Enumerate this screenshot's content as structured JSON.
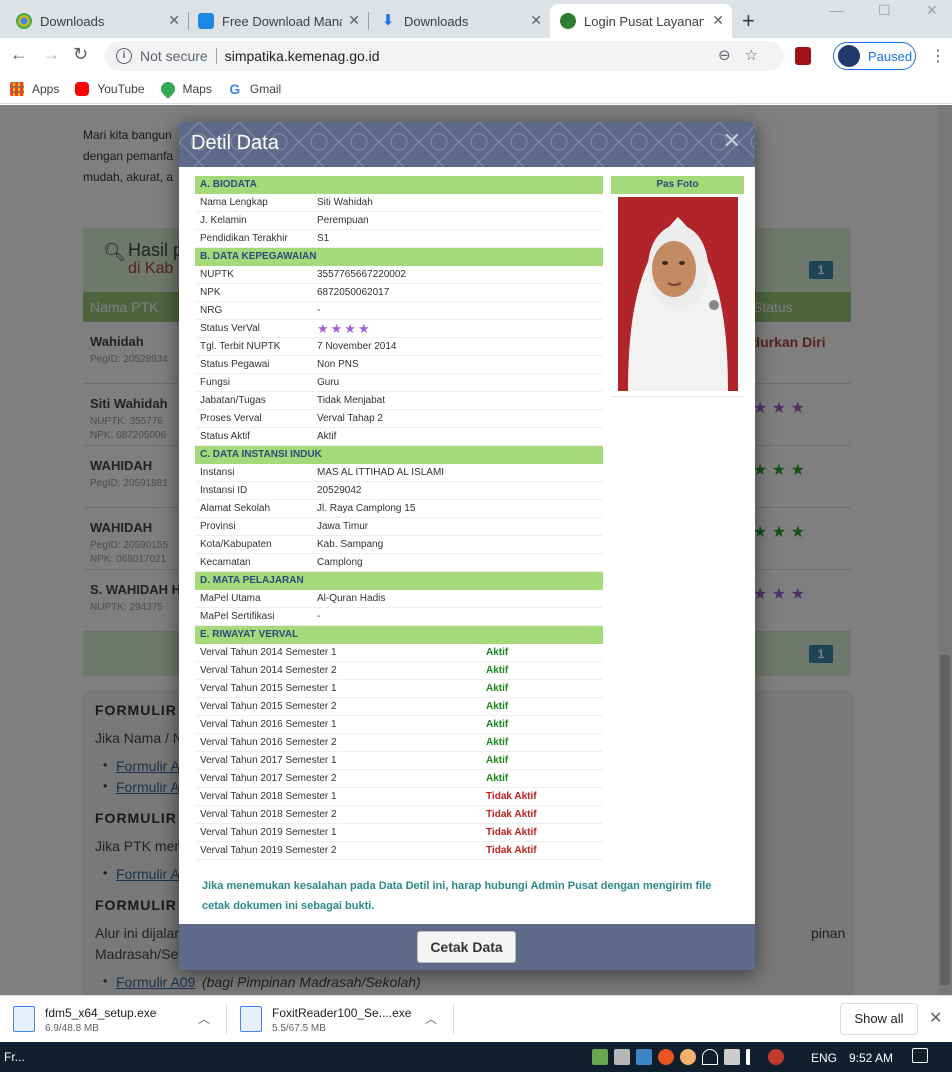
{
  "browser": {
    "tabs": [
      {
        "label": "Downloads",
        "icon": "chrome-icon",
        "active": false
      },
      {
        "label": "Free Download Manag",
        "icon": "fdm-icon",
        "active": false
      },
      {
        "label": "Downloads",
        "icon": "download-icon",
        "active": false
      },
      {
        "label": "Login Pusat Layanan P",
        "icon": "kemenag-icon",
        "active": true
      }
    ],
    "address": {
      "security": "Not secure",
      "url": "simpatika.kemenag.go.id"
    },
    "profile_label": "Paused",
    "bookmarks": [
      {
        "label": "Apps",
        "icon": "apps-grid-icon"
      },
      {
        "label": "YouTube",
        "icon": "youtube-icon"
      },
      {
        "label": "Maps",
        "icon": "maps-icon"
      },
      {
        "label": "Gmail",
        "icon": "google-icon"
      }
    ]
  },
  "background": {
    "intro_lines": [
      "Mari kita bangun",
      "dengan pemanfa",
      "mudah, akurat, a"
    ],
    "result_title": "Hasil p",
    "result_subtitle": "di Kab",
    "page_badge": "1",
    "col_name": "Nama PTK",
    "col_status": "Status",
    "rows": [
      {
        "name": "Wahidah",
        "sub1": "PegID: 20528934",
        "sub2": "",
        "status": "ndurkan Diri",
        "stars": ""
      },
      {
        "name": "Siti Wahidah",
        "sub1": "NUPTK: 355776",
        "sub2": "NPK: 687205006",
        "status": "",
        "stars": "★ ★ ★"
      },
      {
        "name": "WAHIDAH",
        "sub1": "PegID: 20591881",
        "sub2": "",
        "status": "",
        "stars": "★ ★ ★"
      },
      {
        "name": "WAHIDAH",
        "sub1": "PegID: 20590155",
        "sub2": "NPK: 068017021",
        "status": "",
        "stars": "★ ★ ★"
      },
      {
        "name": "S. WAHIDAH H",
        "sub1": "NUPTK: 294375",
        "sub2": "",
        "status": "",
        "stars": "★ ★ ★"
      }
    ],
    "bottom_badge": "1",
    "form": {
      "heading1": "FORMULIR",
      "text1": "Jika Nama / NU",
      "link1a": "Formulir A",
      "link1b": "Formulir A",
      "heading2": "FORMULIR",
      "text2": "Jika PTK meng",
      "link2a": "Formulir A",
      "heading3": "FORMULIR",
      "text3a": "Alur ini dijalani",
      "text3a_right": "pinan",
      "text3b": "Madrasah/Seko",
      "link3a": "Formulir A09",
      "link3a_note": "(bagi Pimpinan Madrasah/Sekolah)"
    }
  },
  "modal": {
    "title": "Detil Data",
    "photo_header": "Pas Foto",
    "sections": [
      {
        "title": "A. BIODATA",
        "rows": [
          {
            "label": "Nama Lengkap",
            "value": "Siti Wahidah"
          },
          {
            "label": "J. Kelamin",
            "value": "Perempuan"
          },
          {
            "label": "Pendidikan Terakhir",
            "value": "S1"
          }
        ]
      },
      {
        "title": "B. DATA KEPEGAWAIAN",
        "rows": [
          {
            "label": "NUPTK",
            "value": "3557765667220002"
          },
          {
            "label": "NPK",
            "value": "6872050062017"
          },
          {
            "label": "NRG",
            "value": "-"
          },
          {
            "label": "Status VerVal",
            "value": "★★★★"
          },
          {
            "label": "Tgl. Terbit NUPTK",
            "value": "7 November 2014"
          },
          {
            "label": "Status Pegawai",
            "value": "Non PNS"
          },
          {
            "label": "Fungsi",
            "value": "Guru"
          },
          {
            "label": "Jabatan/Tugas",
            "value": "Tidak Menjabat"
          },
          {
            "label": "Proses Verval",
            "value": "Verval Tahap 2"
          },
          {
            "label": "Status Aktif",
            "value": "Aktif"
          }
        ]
      },
      {
        "title": "C. DATA INSTANSI INDUK",
        "rows": [
          {
            "label": "Instansi",
            "value": "MAS AL ITTIHAD AL ISLAMI"
          },
          {
            "label": "Instansi ID",
            "value": "20529042"
          },
          {
            "label": "Alamat Sekolah",
            "value": "Jl. Raya Camplong 15"
          },
          {
            "label": "Provinsi",
            "value": "Jawa Timur"
          },
          {
            "label": "Kota/Kabupaten",
            "value": "Kab. Sampang"
          },
          {
            "label": "Kecamatan",
            "value": "Camplong"
          }
        ]
      },
      {
        "title": "D. MATA PELAJARAN",
        "rows": [
          {
            "label": "MaPel Utama",
            "value": "Al-Quran Hadis"
          },
          {
            "label": "MaPel Sertifikasi",
            "value": "-"
          }
        ]
      }
    ],
    "verval_title": "E. RIWAYAT VERVAL",
    "verval": [
      {
        "period": "Verval Tahun 2014 Semester 1",
        "status": "Aktif"
      },
      {
        "period": "Verval Tahun 2014 Semester 2",
        "status": "Aktif"
      },
      {
        "period": "Verval Tahun 2015 Semester 1",
        "status": "Aktif"
      },
      {
        "period": "Verval Tahun 2015 Semester 2",
        "status": "Aktif"
      },
      {
        "period": "Verval Tahun 2016 Semester 1",
        "status": "Aktif"
      },
      {
        "period": "Verval Tahun 2016 Semester 2",
        "status": "Aktif"
      },
      {
        "period": "Verval Tahun 2017 Semester 1",
        "status": "Aktif"
      },
      {
        "period": "Verval Tahun 2017 Semester 2",
        "status": "Aktif"
      },
      {
        "period": "Verval Tahun 2018 Semester 1",
        "status": "Tidak Aktif"
      },
      {
        "period": "Verval Tahun 2018 Semester 2",
        "status": "Tidak Aktif"
      },
      {
        "period": "Verval Tahun 2019 Semester 1",
        "status": "Tidak Aktif"
      },
      {
        "period": "Verval Tahun 2019 Semester 2",
        "status": "Tidak Aktif"
      }
    ],
    "note": "Jika menemukan kesalahan pada Data Detil ini, harap hubungi Admin Pusat dengan mengirim file cetak dokumen ini sebagai bukti.",
    "print_button": "Cetak Data"
  },
  "downloads": [
    {
      "name": "fdm5_x64_setup.exe",
      "size": "6.9/48.8 MB"
    },
    {
      "name": "FoxitReader100_Se....exe",
      "size": "5.5/67.5 MB"
    }
  ],
  "shelf_show_all": "Show all",
  "taskbar": {
    "left_label": "Fr...",
    "lang": "ENG",
    "time": "9:52 AM"
  },
  "colors": {
    "accent_header": "#5e6a8a",
    "section_green": "#a5d97a",
    "active_green": "#1a8a1a",
    "inactive_red": "#c0201e"
  }
}
